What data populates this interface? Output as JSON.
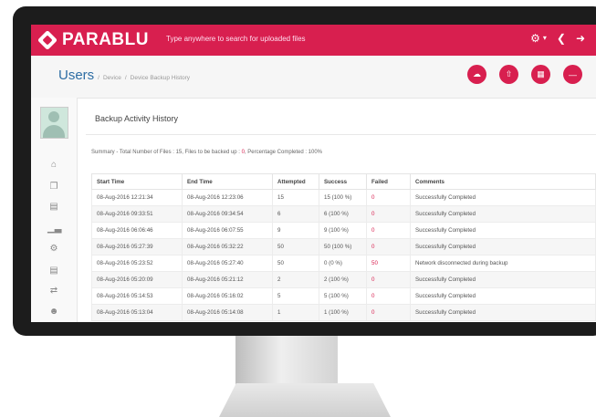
{
  "app": {
    "logo_text": "PARABLU",
    "search_placeholder": "Type anywhere to search for uploaded files",
    "brand_color": "#d81f4f"
  },
  "breadcrumb": {
    "title": "Users",
    "sep1": "/",
    "item1": "Device",
    "sep2": "/",
    "item2": "Device Backup History"
  },
  "topbar_icons": [
    "gear-icon",
    "chevron-down-icon",
    "share-icon",
    "sign-out-icon"
  ],
  "header_buttons": [
    "cloud-icon",
    "upload-icon",
    "folder-icon",
    "minus-icon"
  ],
  "sidebar_icons": [
    "home-icon",
    "copy-icon",
    "database-icon",
    "bar-chart-icon",
    "settings-icon",
    "document-icon",
    "transfer-icon",
    "users-icon"
  ],
  "panel": {
    "title": "Backup Activity History",
    "summary_prefix": "Summary - Total Number of Files : 15, Files to be backed up : ",
    "summary_pending": "0",
    "summary_suffix": ", Percentage Completed : 100%"
  },
  "table": {
    "headers": [
      "Start Time",
      "End Time",
      "Attempted",
      "Success",
      "Failed",
      "Comments"
    ],
    "rows": [
      [
        "08-Aug-2016 12:21:34",
        "08-Aug-2016 12:23:06",
        "15",
        "15 (100 %)",
        "0",
        "Successfully Completed"
      ],
      [
        "08-Aug-2016 09:33:51",
        "08-Aug-2016 09:34:54",
        "6",
        "6 (100 %)",
        "0",
        "Successfully Completed"
      ],
      [
        "08-Aug-2016 06:06:46",
        "08-Aug-2016 06:07:55",
        "9",
        "9 (100 %)",
        "0",
        "Successfully Completed"
      ],
      [
        "08-Aug-2016 05:27:39",
        "08-Aug-2016 05:32:22",
        "50",
        "50 (100 %)",
        "0",
        "Successfully Completed"
      ],
      [
        "08-Aug-2016 05:23:52",
        "08-Aug-2016 05:27:40",
        "50",
        "0 (0 %)",
        "50",
        "Network disconnected during backup"
      ],
      [
        "08-Aug-2016 05:20:09",
        "08-Aug-2016 05:21:12",
        "2",
        "2 (100 %)",
        "0",
        "Successfully Completed"
      ],
      [
        "08-Aug-2016 05:14:53",
        "08-Aug-2016 05:16:02",
        "5",
        "5 (100 %)",
        "0",
        "Successfully Completed"
      ],
      [
        "08-Aug-2016 05:13:04",
        "08-Aug-2016 05:14:08",
        "1",
        "1 (100 %)",
        "0",
        "Successfully Completed"
      ]
    ]
  }
}
